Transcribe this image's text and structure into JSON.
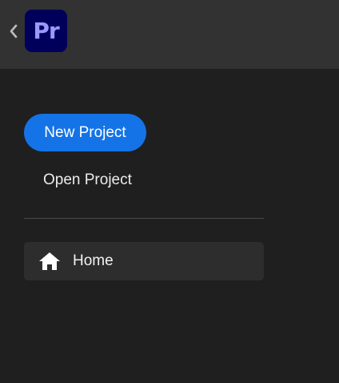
{
  "header": {
    "back_icon": "chevron-left-icon",
    "app_logo_text": "Pr"
  },
  "actions": {
    "new_project_label": "New Project",
    "open_project_label": "Open Project"
  },
  "nav": {
    "items": [
      {
        "icon": "home-icon",
        "label": "Home",
        "selected": true
      }
    ]
  },
  "colors": {
    "accent": "#1473e6",
    "logo_bg": "#00005b",
    "logo_text": "#9999ff",
    "topbar_bg": "#323232",
    "panel_bg": "#1f1f1f",
    "nav_selected_bg": "#2d2d2d"
  }
}
